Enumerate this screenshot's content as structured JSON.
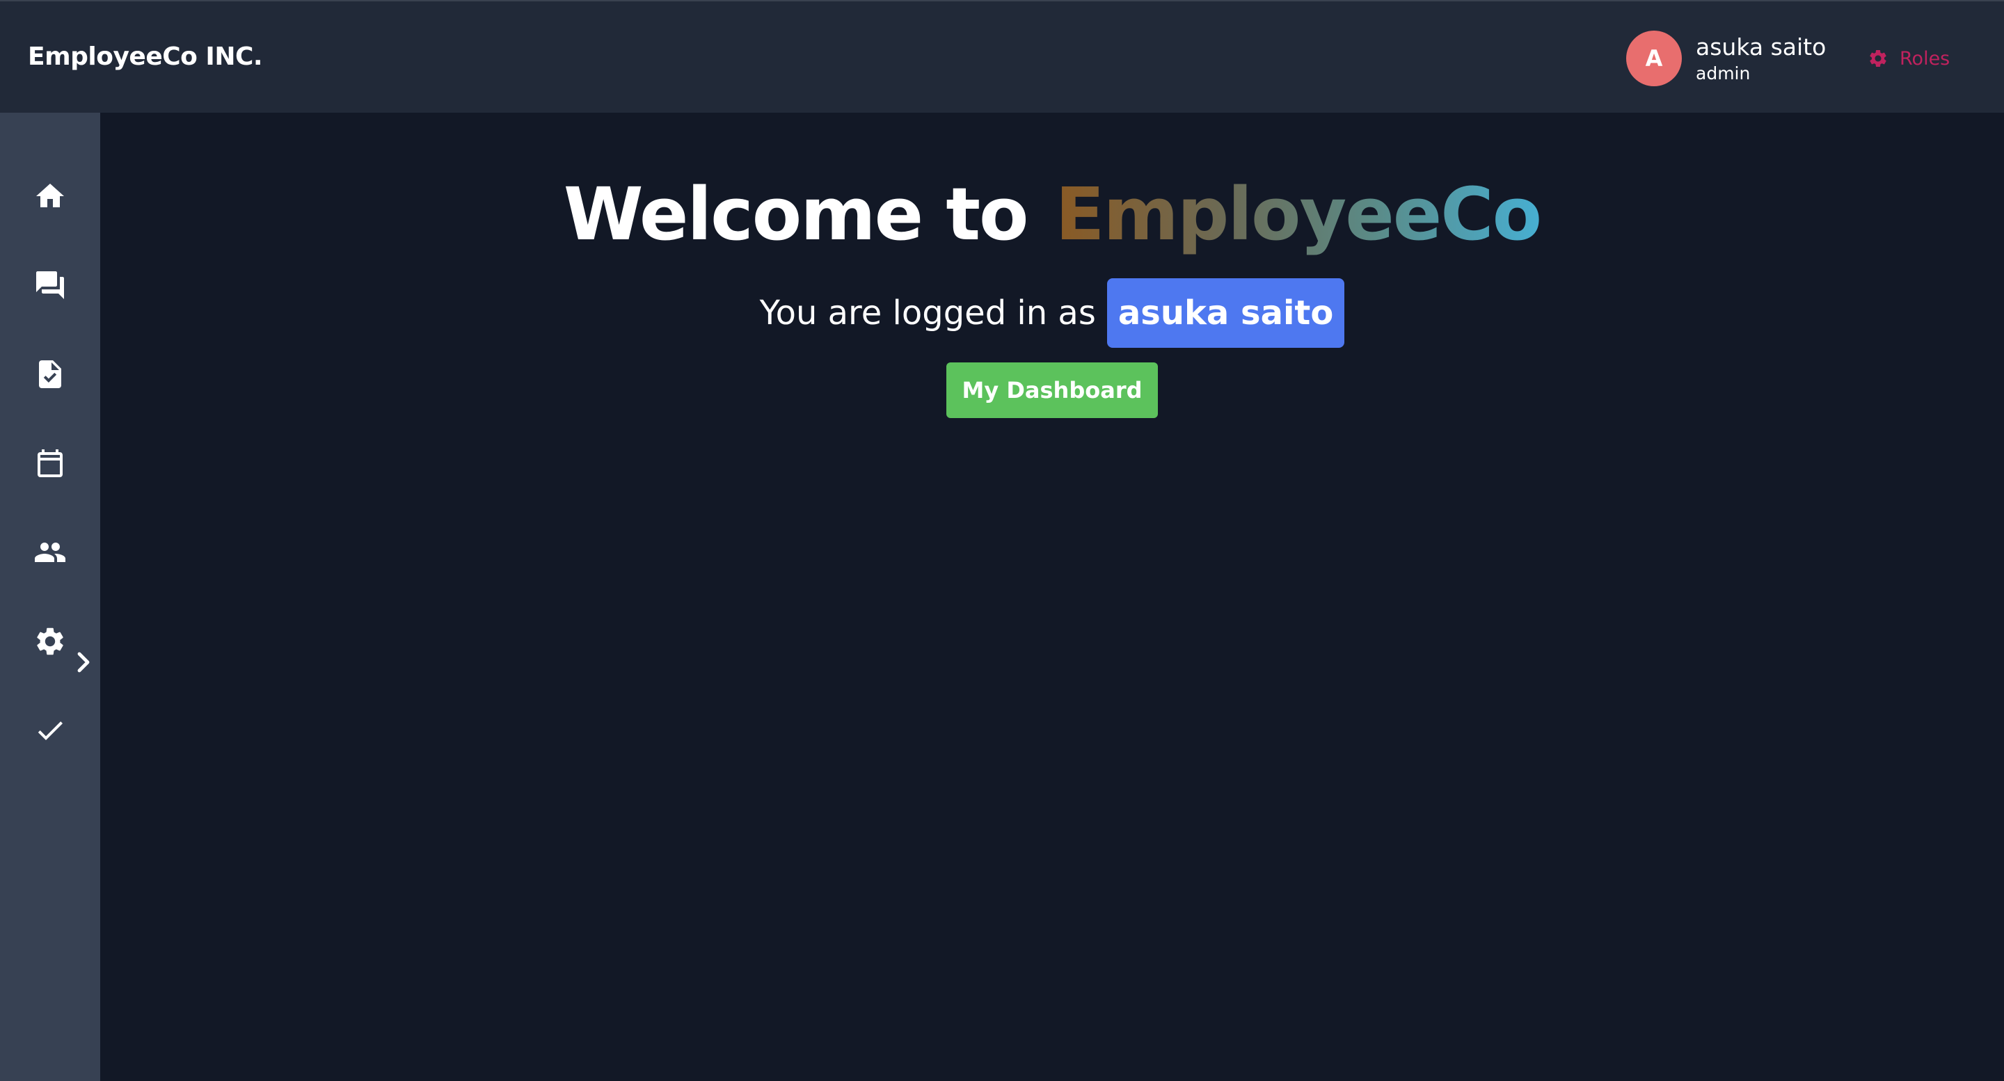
{
  "header": {
    "brand": "EmployeeCo INC.",
    "user": {
      "avatar_letter": "A",
      "name": "asuka saito",
      "role": "admin"
    },
    "roles_label": "Roles"
  },
  "sidebar": {
    "items": [
      {
        "icon": "home-icon"
      },
      {
        "icon": "chat-icon"
      },
      {
        "icon": "task-document-icon"
      },
      {
        "icon": "calendar-icon"
      },
      {
        "icon": "people-icon"
      },
      {
        "icon": "gear-icon",
        "has_submenu": true
      },
      {
        "icon": "checkmark-icon"
      }
    ]
  },
  "main": {
    "welcome_prefix": "Welcome to",
    "welcome_brand": "EmployeeCo",
    "logged_in_text": "You are logged in as",
    "logged_in_user": "asuka saito",
    "dashboard_button": "My Dashboard"
  },
  "colors": {
    "topbar_bg": "#212938",
    "sidebar_bg": "#374153",
    "main_bg": "#121826",
    "avatar_bg": "#e86e6e",
    "roles_accent": "#c0225e",
    "user_badge_bg": "#4e78f0",
    "dashboard_button_bg": "#5cc25c"
  }
}
